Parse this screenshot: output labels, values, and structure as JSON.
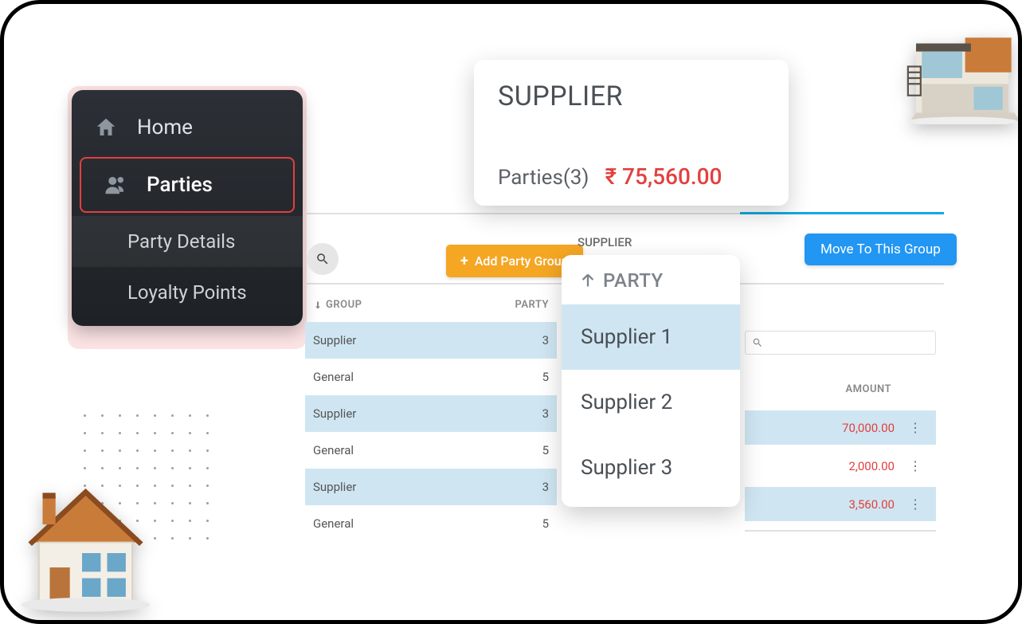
{
  "sidebar": {
    "home": "Home",
    "parties": "Parties",
    "party_details": "Party Details",
    "loyalty_points": "Loyalty Points"
  },
  "toolbar": {
    "add_party_group": "Add Party Group",
    "supplier_label": "SUPPLIER",
    "move_button": "Move To This Group"
  },
  "left_table": {
    "col_group": "GROUP",
    "col_party": "PARTY",
    "rows": [
      {
        "group": "Supplier",
        "party": "3"
      },
      {
        "group": "General",
        "party": "5"
      },
      {
        "group": "Supplier",
        "party": "3"
      },
      {
        "group": "General",
        "party": "5"
      },
      {
        "group": "Supplier",
        "party": "3"
      },
      {
        "group": "General",
        "party": "5"
      }
    ]
  },
  "right_table": {
    "col_amount": "AMOUNT",
    "rows": [
      {
        "amount": "70,000.00"
      },
      {
        "amount": "2,000.00"
      },
      {
        "amount": "3,560.00"
      }
    ]
  },
  "supplier_card": {
    "title": "SUPPLIER",
    "parties_label": "Parties(3)",
    "amount": "₹ 75,560.00"
  },
  "party_popover": {
    "title": "PARTY",
    "items": [
      "Supplier 1",
      "Supplier 2",
      "Supplier 3"
    ]
  }
}
